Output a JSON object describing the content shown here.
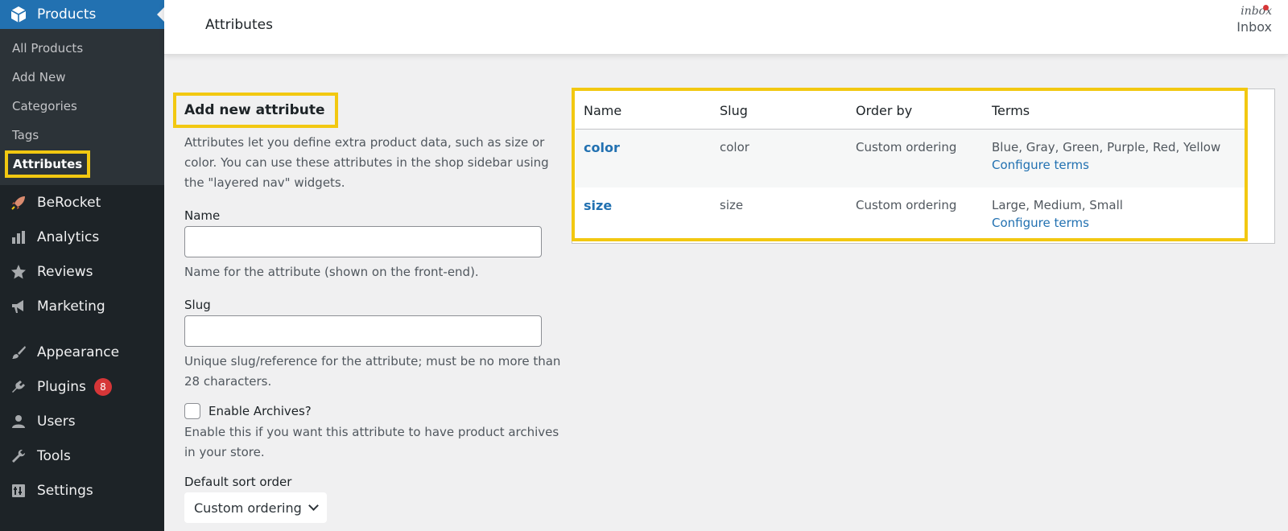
{
  "sidebar": {
    "current": {
      "label": "Products",
      "icon": "box-icon"
    },
    "submenu": [
      {
        "label": "All Products"
      },
      {
        "label": "Add New"
      },
      {
        "label": "Categories"
      },
      {
        "label": "Tags"
      },
      {
        "label": "Attributes",
        "active": true
      }
    ],
    "menu": [
      {
        "label": "BeRocket",
        "icon": "rocket-icon"
      },
      {
        "label": "Analytics",
        "icon": "bar-chart-icon"
      },
      {
        "label": "Reviews",
        "icon": "star-icon"
      },
      {
        "label": "Marketing",
        "icon": "megaphone-icon"
      },
      {
        "label": "Appearance",
        "icon": "paintbrush-icon"
      },
      {
        "label": "Plugins",
        "icon": "plugin-icon",
        "badge": "8"
      },
      {
        "label": "Users",
        "icon": "user-icon"
      },
      {
        "label": "Tools",
        "icon": "wrench-icon"
      },
      {
        "label": "Settings",
        "icon": "settings-icon"
      }
    ]
  },
  "header": {
    "title": "Attributes",
    "inbox_icon_text": "inbox",
    "inbox_label": "Inbox"
  },
  "form": {
    "heading": "Add new attribute",
    "intro": "Attributes let you define extra product data, such as size or color. You can use these attributes in the shop sidebar using the \"layered nav\" widgets.",
    "name_label": "Name",
    "name_value": "",
    "name_help": "Name for the attribute (shown on the front-end).",
    "slug_label": "Slug",
    "slug_value": "",
    "slug_help": "Unique slug/reference for the attribute; must be no more than 28 characters.",
    "archives_label": "Enable Archives?",
    "archives_checked": false,
    "archives_help": "Enable this if you want this attribute to have product archives in your store.",
    "sort_label": "Default sort order",
    "sort_value": "Custom ordering"
  },
  "table": {
    "headers": {
      "name": "Name",
      "slug": "Slug",
      "order": "Order by",
      "terms": "Terms"
    },
    "rows": [
      {
        "name": "color",
        "slug": "color",
        "order": "Custom ordering",
        "terms": "Blue, Gray, Green, Purple, Red, Yellow",
        "configure": "Configure terms"
      },
      {
        "name": "size",
        "slug": "size",
        "order": "Custom ordering",
        "terms": "Large, Medium, Small",
        "configure": "Configure terms"
      }
    ]
  },
  "colors": {
    "sidebar_bg": "#1d2327",
    "accent": "#2271b1",
    "highlight": "#f2c811",
    "badge": "#d63638"
  }
}
